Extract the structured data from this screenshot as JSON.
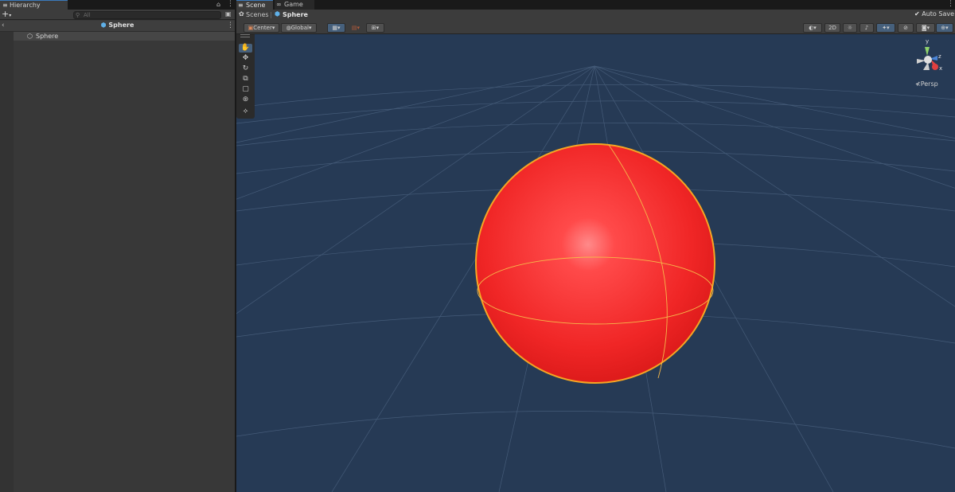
{
  "hierarchy": {
    "tab_label": "Hierarchy",
    "search_placeholder": "All",
    "scene_name": "Sphere",
    "items": [
      {
        "label": "Sphere"
      }
    ]
  },
  "scene_view": {
    "tabs": [
      {
        "label": "Scene"
      },
      {
        "label": "Game"
      }
    ],
    "breadcrumb": {
      "root": "Scenes",
      "current": "Sphere"
    },
    "auto_save_label": "Auto Save",
    "auto_save_checked": true,
    "pivot_mode": "Center",
    "pivot_rotation": "Global",
    "toggle_2d": "2D",
    "gizmo_axes": {
      "y": "y",
      "z": "z",
      "x": "x"
    },
    "projection_label": "Persp",
    "tools": [
      "hand-tool",
      "move-tool",
      "rotate-tool",
      "scale-tool",
      "rect-tool",
      "transform-tool",
      "custom-tool"
    ],
    "active_tool": "hand-tool"
  },
  "colors": {
    "accent": "#3a79bb",
    "sphere": "#ff2a2a",
    "selection_outline": "#f5a623",
    "viewport_bg": "#263a55"
  }
}
